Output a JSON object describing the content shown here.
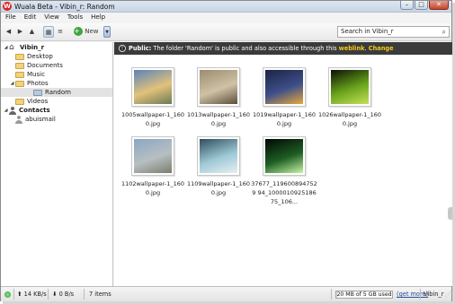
{
  "window": {
    "app_icon_letter": "W",
    "title": "Wuala Beta - Vibin_r: Random",
    "buttons": [
      "–",
      "□",
      "✕"
    ]
  },
  "menu": [
    "File",
    "Edit",
    "View",
    "Tools",
    "Help"
  ],
  "toolbar": {
    "back_icon": "◀",
    "forward_icon": "▶",
    "up_icon": "▲",
    "grid_view_icon": "▦",
    "list_view_icon": "≡",
    "new_icon": "+",
    "new_label": "New",
    "dropdown_icon": "▼",
    "search_value": "Search in Vibin_r",
    "search_icon": "⌕"
  },
  "sidebar": {
    "root": {
      "label": "Vibin_r",
      "arrow": "◢"
    },
    "folders": [
      {
        "label": "Desktop",
        "arrow": ""
      },
      {
        "label": "Documents",
        "arrow": ""
      },
      {
        "label": "Music",
        "arrow": ""
      },
      {
        "label": "Photos",
        "arrow": "◢"
      },
      {
        "label": "Random",
        "arrow": ""
      },
      {
        "label": "Videos",
        "arrow": ""
      }
    ],
    "contacts": {
      "label": "Contacts",
      "arrow": "◢"
    },
    "contact_items": [
      {
        "label": "abuismail"
      }
    ]
  },
  "banner": {
    "icon": "!",
    "prefix": "Public:",
    "text": " The folder 'Random' is public and also accessible through this ",
    "link": "weblink",
    "separator": ".  ",
    "change": "Change"
  },
  "files": [
    {
      "name": "1005wallpaper-1_1600.jpg",
      "colors": [
        "#5b83b8",
        "#e2c27c",
        "#6b7a55"
      ]
    },
    {
      "name": "1013wallpaper-1_1600.jpg",
      "colors": [
        "#9c8b70",
        "#cfc2a5",
        "#5b4d3a"
      ]
    },
    {
      "name": "1019wallpaper-1_1600.jpg",
      "colors": [
        "#1c2444",
        "#3d4f8a",
        "#e6a83a"
      ]
    },
    {
      "name": "1026wallpaper-1_1600.jpg",
      "colors": [
        "#0b1205",
        "#6aa51c",
        "#c7e05a"
      ]
    },
    {
      "name": "1102wallpaper-1_1600.jpg",
      "colors": [
        "#8ba6c2",
        "#b7bfc1",
        "#7c7c70"
      ]
    },
    {
      "name": "1109wallpaper-1_1600.jpg",
      "colors": [
        "#2f4d5c",
        "#9ec9d6",
        "#e8f0f0"
      ]
    },
    {
      "name": "37677_1196008947529 94_100001092518675_106...",
      "colors": [
        "#020603",
        "#1e5f23",
        "#c7f5a8"
      ]
    }
  ],
  "status": {
    "upload_icon": "⬆",
    "upload": "14 KB/s",
    "download_icon": "⬇",
    "download": "0 B/s",
    "item_count": "7 items",
    "storage_used": "20 MB of 5 GB used",
    "storage_fraction": 0.004,
    "get_more": "(get more)",
    "user": "Vibin_r",
    "resize_icon": "⋰"
  }
}
